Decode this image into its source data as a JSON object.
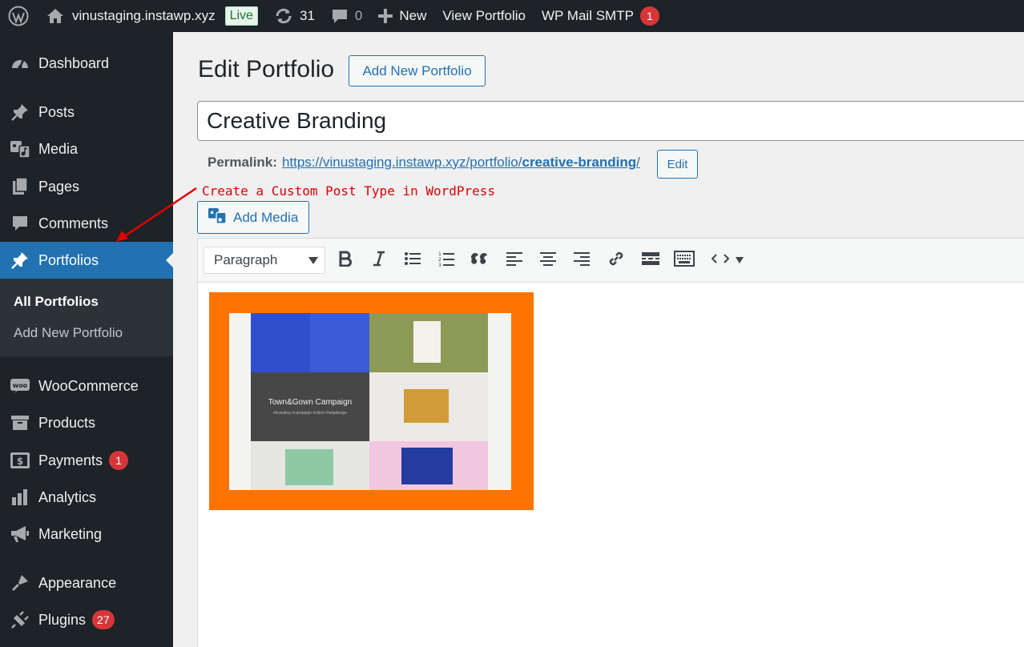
{
  "adminbar": {
    "site_name": "vinustaging.instawp.xyz",
    "live_badge": "Live",
    "updates_count": "31",
    "comments_count": "0",
    "new_label": "New",
    "view_label": "View Portfolio",
    "smtp_label": "WP Mail SMTP",
    "smtp_count": "1"
  },
  "sidebar": {
    "items": [
      {
        "label": "Dashboard",
        "icon": "dashboard-icon"
      },
      {
        "label": "Posts",
        "icon": "pin-icon"
      },
      {
        "label": "Media",
        "icon": "media-icon"
      },
      {
        "label": "Pages",
        "icon": "pages-icon"
      },
      {
        "label": "Comments",
        "icon": "comment-icon"
      },
      {
        "label": "Portfolios",
        "icon": "pin-icon"
      },
      {
        "label": "WooCommerce",
        "icon": "woo-icon"
      },
      {
        "label": "Products",
        "icon": "archive-icon"
      },
      {
        "label": "Payments",
        "icon": "dollar-icon",
        "count": "1"
      },
      {
        "label": "Analytics",
        "icon": "bar-chart-icon"
      },
      {
        "label": "Marketing",
        "icon": "megaphone-icon"
      },
      {
        "label": "Appearance",
        "icon": "brush-icon"
      },
      {
        "label": "Plugins",
        "icon": "plug-icon",
        "count": "27"
      }
    ],
    "submenu": [
      "All Portfolios",
      "Add New Portfolio"
    ]
  },
  "main": {
    "page_title": "Edit Portfolio",
    "add_new_label": "Add New Portfolio",
    "post_title": "Creative Branding",
    "permalink_label": "Permalink:",
    "permalink_base": "https://vinustaging.instawp.xyz/portfolio/",
    "permalink_slug": "creative-branding",
    "permalink_trailing": "/",
    "edit_label": "Edit",
    "annotation": "Create a Custom Post Type in WordPress",
    "add_media_label": "Add Media",
    "format_value": "Paragraph",
    "image_caption": "Town&Gown Campaign",
    "image_subcaption": "#branding #campaign #client #helpdesign"
  },
  "colors": {
    "admin_dark": "#1d2327",
    "accent": "#2271b1",
    "badge_red": "#d63638",
    "image_bg": "#ff7300"
  }
}
